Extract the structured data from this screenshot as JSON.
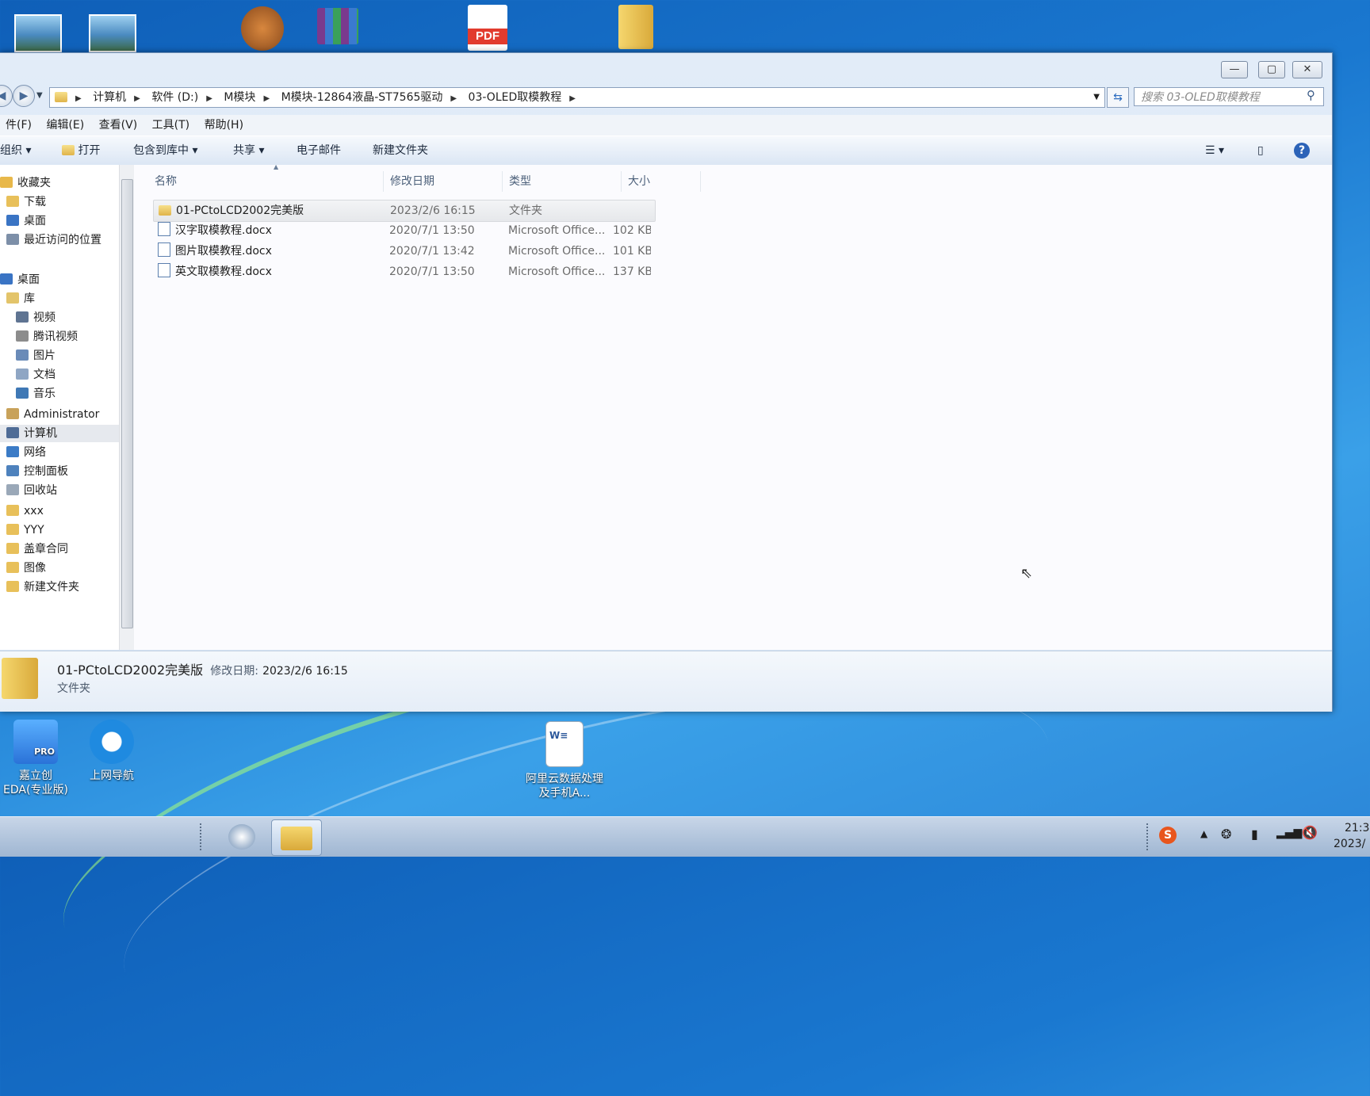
{
  "desktop": {
    "top_icons": [
      "landscape-image-icon",
      "landscape-image-icon",
      "bear-app-icon",
      "winrar-icon",
      "pdf-icon",
      "folder-icon"
    ],
    "pdf_label": "PDF",
    "bottom_icons": [
      {
        "name": "jlc-eda-icon",
        "label": "嘉立创EDA(专业版)",
        "badge": "PRO"
      },
      {
        "name": "ie-icon",
        "label": "上网导航"
      },
      {
        "name": "word-doc-icon",
        "label": "阿里云数据处理及手机A...",
        "badge": "W≡"
      }
    ]
  },
  "window": {
    "controls": {
      "minimize": "—",
      "maximize": "▢",
      "close": "✕"
    },
    "address": {
      "crumbs": [
        "计算机",
        "软件 (D:)",
        "M模块",
        "M模块-12864液晶-ST7565驱动",
        "03-OLED取模教程"
      ]
    },
    "search_placeholder": "搜索 03-OLED取模教程",
    "menu": [
      "件(F)",
      "编辑(E)",
      "查看(V)",
      "工具(T)",
      "帮助(H)"
    ],
    "toolbar": {
      "organize": "组织 ▾",
      "open": "打开",
      "include": "包含到库中 ▾",
      "share": "共享 ▾",
      "email": "电子邮件",
      "new_folder": "新建文件夹"
    },
    "nav": [
      {
        "label": "收藏夹",
        "icon": "star-icon",
        "color": "#e8b84a"
      },
      {
        "label": "下载",
        "icon": "folder-icon",
        "color": "#e8c05a"
      },
      {
        "label": "桌面",
        "icon": "desktop-icon",
        "color": "#3a74c4"
      },
      {
        "label": "最近访问的位置",
        "icon": "recent-places-icon",
        "color": "#7d8fa8"
      },
      {
        "label": "桌面",
        "icon": "desktop-icon",
        "color": "#3a74c4"
      },
      {
        "label": "库",
        "icon": "library-icon",
        "color": "#e3c46a"
      },
      {
        "label": "视频",
        "icon": "video-icon",
        "color": "#5f7492"
      },
      {
        "label": "腾讯视频",
        "icon": "tencent-video-icon",
        "color": "#8c8c8c"
      },
      {
        "label": "图片",
        "icon": "pictures-icon",
        "color": "#6a8bb8"
      },
      {
        "label": "文档",
        "icon": "documents-icon",
        "color": "#8fa6c4"
      },
      {
        "label": "音乐",
        "icon": "music-icon",
        "color": "#3f78b5"
      },
      {
        "label": "Administrator",
        "icon": "user-folder-icon",
        "color": "#c8a25a"
      },
      {
        "label": "计算机",
        "icon": "computer-icon",
        "color": "#4f6c96"
      },
      {
        "label": "网络",
        "icon": "network-icon",
        "color": "#3b7bc6"
      },
      {
        "label": "控制面板",
        "icon": "control-panel-icon",
        "color": "#4e82bd"
      },
      {
        "label": "回收站",
        "icon": "recycle-bin-icon",
        "color": "#9aa8b8"
      },
      {
        "label": "xxx",
        "icon": "folder-icon",
        "color": "#e8c05a"
      },
      {
        "label": "YYY",
        "icon": "folder-icon",
        "color": "#e8c05a"
      },
      {
        "label": "盖章合同",
        "icon": "folder-icon",
        "color": "#e8c05a"
      },
      {
        "label": "图像",
        "icon": "folder-icon",
        "color": "#e8c05a"
      },
      {
        "label": "新建文件夹",
        "icon": "folder-icon",
        "color": "#e8c05a"
      }
    ],
    "columns": [
      "名称",
      "修改日期",
      "类型",
      "大小"
    ],
    "files": [
      {
        "name": "01-PCtoLCD2002完美版",
        "date": "2023/2/6 16:15",
        "type": "文件夹",
        "size": "",
        "kind": "folder"
      },
      {
        "name": "汉字取模教程.docx",
        "date": "2020/7/1 13:50",
        "type": "Microsoft Office...",
        "size": "102 KB",
        "kind": "doc"
      },
      {
        "name": "图片取模教程.docx",
        "date": "2020/7/1 13:42",
        "type": "Microsoft Office...",
        "size": "101 KB",
        "kind": "doc"
      },
      {
        "name": "英文取模教程.docx",
        "date": "2020/7/1 13:50",
        "type": "Microsoft Office...",
        "size": "137 KB",
        "kind": "doc"
      }
    ],
    "details": {
      "name": "01-PCtoLCD2002完美版",
      "date_label": "修改日期:",
      "date": "2023/2/6 16:15",
      "type": "文件夹"
    }
  },
  "taskbar": {
    "clock_time": "21:3",
    "clock_date": "2023/"
  },
  "colors": {
    "accent": "#1a78d0",
    "selection": "#e6e8eb"
  }
}
